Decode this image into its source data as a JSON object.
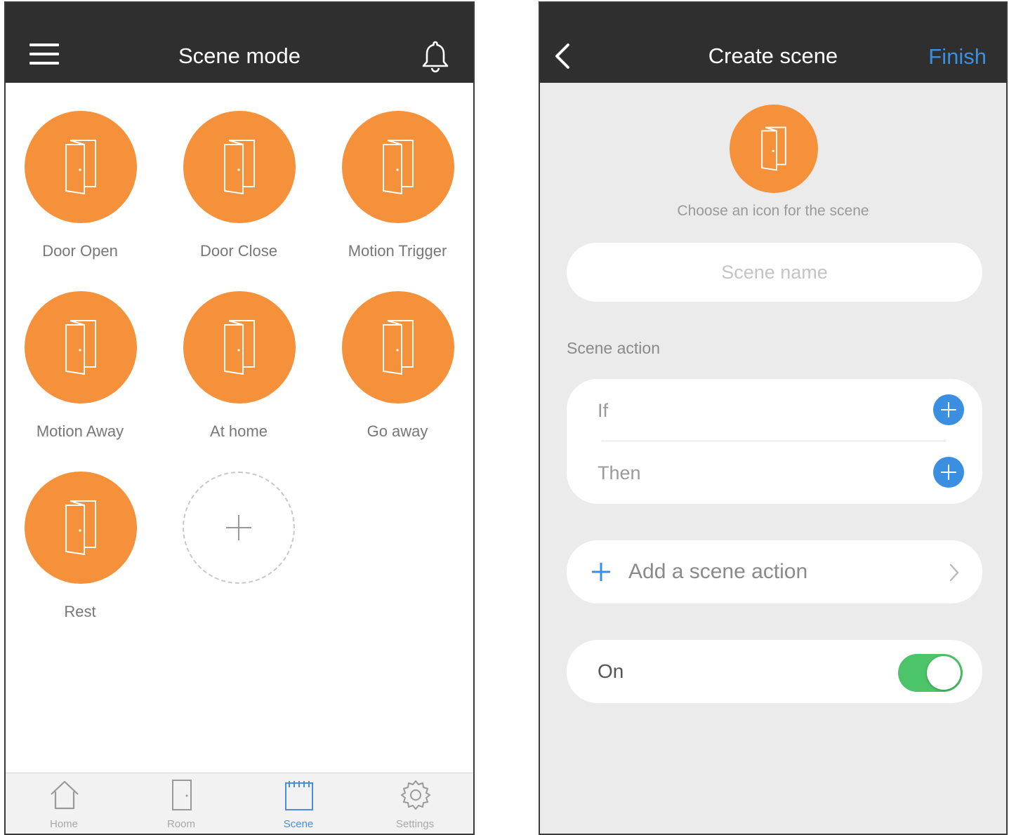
{
  "scene_mode": {
    "title": "Scene mode",
    "scenes": [
      {
        "label": "Door Open",
        "icon": "door-icon"
      },
      {
        "label": "Door Close",
        "icon": "door-icon"
      },
      {
        "label": "Motion Trigger",
        "icon": "door-icon"
      },
      {
        "label": "Motion Away",
        "icon": "door-icon"
      },
      {
        "label": "At home",
        "icon": "door-icon"
      },
      {
        "label": "Go away",
        "icon": "door-icon"
      },
      {
        "label": "Rest",
        "icon": "door-icon"
      }
    ],
    "add_icon": "plus-icon",
    "tabs": [
      {
        "label": "Home",
        "icon": "home-icon",
        "active": false
      },
      {
        "label": "Room",
        "icon": "room-door-icon",
        "active": false
      },
      {
        "label": "Scene",
        "icon": "scene-icon",
        "active": true
      },
      {
        "label": "Settings",
        "icon": "gear-icon",
        "active": false
      }
    ]
  },
  "create_scene": {
    "title": "Create scene",
    "finish_label": "Finish",
    "icon_hint": "Choose an icon for the scene",
    "scene_name_placeholder": "Scene name",
    "scene_action_label": "Scene action",
    "if_label": "If",
    "then_label": "Then",
    "add_action_label": "Add a scene action",
    "on_label": "On",
    "enabled": true
  },
  "colors": {
    "accent_orange": "#f5913a",
    "nav_bar": "#2f2f2f",
    "link_blue": "#3b8fe0",
    "toggle_green": "#4cc46a"
  }
}
